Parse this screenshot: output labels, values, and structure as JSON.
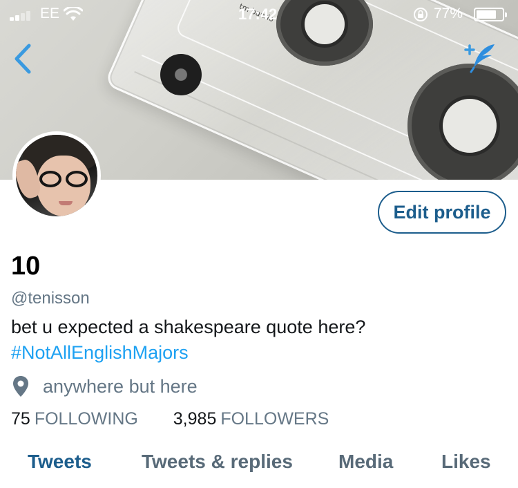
{
  "status_bar": {
    "carrier": "EE",
    "time": "17:42",
    "battery_percent": "77%",
    "battery_level": 0.77
  },
  "banner": {
    "tape_label": "tm bando"
  },
  "profile": {
    "display_name": "10",
    "handle": "@tenisson",
    "bio": "bet u expected a shakespeare quote here?",
    "hashtag": "#NotAllEnglishMajors",
    "location": "anywhere but here",
    "edit_label": "Edit profile"
  },
  "stats": {
    "following_count": "75",
    "following_label": "FOLLOWING",
    "followers_count": "3,985",
    "followers_label": "FOLLOWERS"
  },
  "tabs": [
    {
      "label": "Tweets",
      "active": true
    },
    {
      "label": "Tweets & replies",
      "active": false
    },
    {
      "label": "Media",
      "active": false
    },
    {
      "label": "Likes",
      "active": false
    }
  ],
  "icons": {
    "back": "chevron-left-icon",
    "compose": "feather-icon",
    "location": "location-pin-icon",
    "lock": "orientation-lock-icon",
    "wifi": "wifi-icon"
  },
  "colors": {
    "accent": "#1da1f2",
    "link_dark": "#1c5d8c",
    "muted": "#657786",
    "text": "#14171a"
  }
}
